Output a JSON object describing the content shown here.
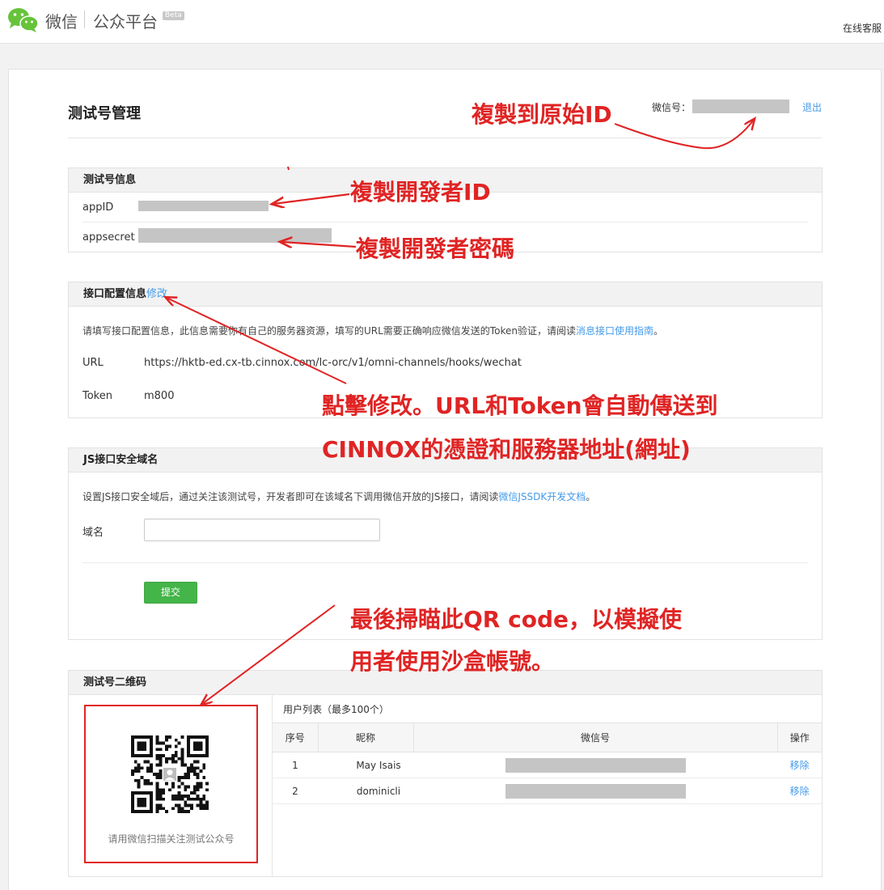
{
  "header": {
    "logo_wechat": "微信",
    "logo_platform": "公众平台",
    "beta": "Beta",
    "online_service": "在线客服"
  },
  "page": {
    "title": "测试号管理",
    "wxid_label": "微信号：",
    "logout": "退出"
  },
  "test_info": {
    "heading": "测试号信息",
    "appid_label": "appID",
    "appsecret_label": "appsecret"
  },
  "interface": {
    "heading": "接口配置信息",
    "edit_link": "修改",
    "desc_prefix": "请填写接口配置信息，此信息需要你有自己的服务器资源，填写的URL需要正确响应微信发送的Token验证，请阅读",
    "desc_link": "消息接口使用指南",
    "desc_suffix": "。",
    "url_label": "URL",
    "url_value": "https://hktb-ed.cx-tb.cinnox.com/lc-orc/v1/omni-channels/hooks/wechat",
    "token_label": "Token",
    "token_value": "m800"
  },
  "js_domain": {
    "heading": "JS接口安全域名",
    "desc_prefix": "设置JS接口安全域后，通过关注该测试号，开发者即可在该域名下调用微信开放的JS接口，请阅读",
    "desc_link": "微信JSSDK开发文档",
    "desc_suffix": "。",
    "domain_label": "域名",
    "domain_value": "",
    "submit": "提交"
  },
  "qr": {
    "heading": "测试号二维码",
    "caption": "请用微信扫描关注测试公众号",
    "userlist_title": "用户列表（最多100个）",
    "columns": [
      "序号",
      "昵称",
      "微信号",
      "操作"
    ],
    "rows": [
      {
        "index": "1",
        "nickname": "May Isais",
        "action": "移除"
      },
      {
        "index": "2",
        "nickname": "dominicli",
        "action": "移除"
      }
    ]
  },
  "annotations": {
    "copy_original_id": "複製到原始ID",
    "copy_dev_id": "複製開發者ID",
    "copy_dev_secret": "複製開發者密碼",
    "click_edit_line1": "點擊修改。URL和Token會自動傳送到",
    "click_edit_line2": "CINNOX的憑證和服務器地址(網址)",
    "scan_line1": "最後掃瞄此QR code，以模擬使",
    "scan_line2": "用者使用沙盒帳號。"
  },
  "colors": {
    "accent_green": "#44b549",
    "link_blue": "#459ae9",
    "annotation_red": "#e02424"
  }
}
